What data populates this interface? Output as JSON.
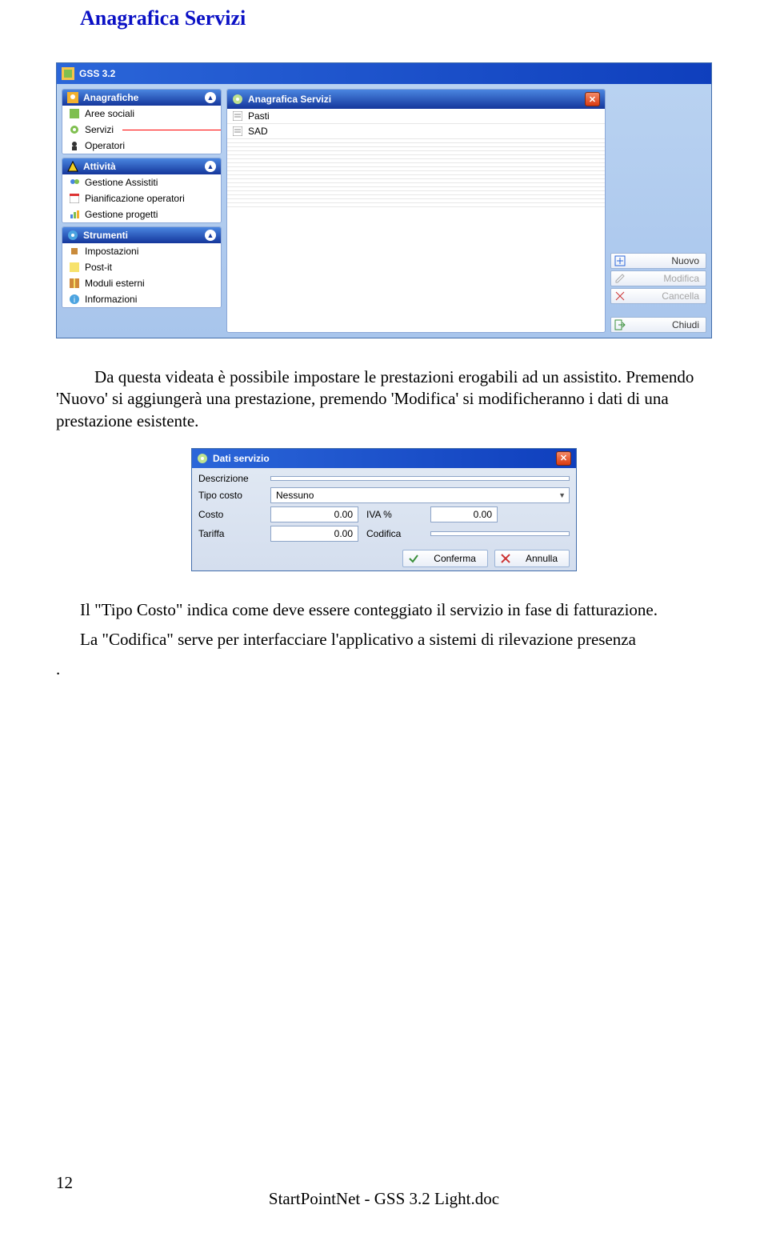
{
  "heading": "Anagrafica Servizi",
  "para1": "Da questa videata è possibile impostare le prestazioni erogabili ad un assistito. Premendo 'Nuovo' si aggiungerà una prestazione, premendo 'Modifica' si modificheranno i dati di una prestazione esistente.",
  "para2": "Il \"Tipo Costo\" indica come deve essere conteggiato il servizio in fase di fatturazione.",
  "para3": "La \"Codifica\" serve per interfacciare l'applicativo a sistemi di rilevazione presenza",
  "para4": ".",
  "app": {
    "title": "GSS 3.2",
    "nav": {
      "group1": {
        "title": "Anagrafiche",
        "items": [
          "Aree sociali",
          "Servizi",
          "Operatori"
        ]
      },
      "group2": {
        "title": "Attività",
        "items": [
          "Gestione Assistiti",
          "Pianificazione operatori",
          "Gestione progetti"
        ]
      },
      "group3": {
        "title": "Strumenti",
        "items": [
          "Impostazioni",
          "Post-it",
          "Moduli esterni",
          "Informazioni"
        ]
      }
    },
    "panel": {
      "title": "Anagrafica Servizi",
      "rows": [
        "Pasti",
        "SAD"
      ]
    },
    "actions": {
      "nuovo": "Nuovo",
      "modifica": "Modifica",
      "cancella": "Cancella",
      "chiudi": "Chiudi"
    }
  },
  "dialog": {
    "title": "Dati servizio",
    "labels": {
      "descrizione": "Descrizione",
      "tipocosto": "Tipo costo",
      "costo": "Costo",
      "iva": "IVA %",
      "tariffa": "Tariffa",
      "codifica": "Codifica"
    },
    "values": {
      "descrizione": "",
      "tipocosto": "Nessuno",
      "costo": "0.00",
      "iva": "0.00",
      "tariffa": "0.00",
      "codifica": ""
    },
    "buttons": {
      "conferma": "Conferma",
      "annulla": "Annulla"
    }
  },
  "footer": {
    "page": "12",
    "text": "StartPointNet - GSS 3.2 Light.doc"
  }
}
